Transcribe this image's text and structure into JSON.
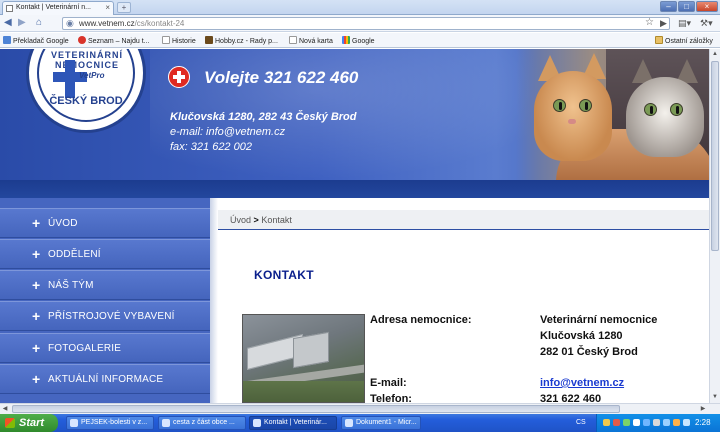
{
  "browser": {
    "tab_title": "Kontakt | Veterinární n...",
    "tab_close": "×",
    "new_tab": "+",
    "url_host": "www.vetnem.cz",
    "url_path": "/cs/kontakt-24",
    "window_controls": {
      "minimize": "–",
      "maximize": "□",
      "close": "×"
    },
    "nav_icons": {
      "back": "back-arrow-icon",
      "forward": "forward-arrow-icon",
      "home": "home-icon",
      "star": "star-icon",
      "go": "go-arrow-icon",
      "page": "page-menu-icon",
      "tools": "wrench-icon"
    },
    "bookmarks": [
      {
        "label": "Překladač Google"
      },
      {
        "label": "Seznam – Najdu t..."
      },
      {
        "label": "Historie"
      },
      {
        "label": "Hobby.cz - Rady p..."
      },
      {
        "label": "Nová karta"
      },
      {
        "label": "Google"
      }
    ],
    "other_bookmarks": "Ostatní záložky"
  },
  "header": {
    "logo_top_text": "VETERINÁRNÍ NEMOCNICE",
    "logo_brand": "VetPro",
    "logo_city": "ČESKÝ BROD",
    "call_text": "Volejte 321 622 460",
    "address": "Klučovská 1280, 282 43 Český Brod",
    "email": "e-mail: info@vetnem.cz",
    "fax": "fax: 321 622 002"
  },
  "menu": {
    "plus": "+",
    "items": [
      {
        "label": "ÚVOD"
      },
      {
        "label": "ODDĚLENÍ"
      },
      {
        "label": "NÁŠ TÝM"
      },
      {
        "label": "PŘÍSTROJOVÉ VYBAVENÍ"
      },
      {
        "label": "FOTOGALERIE"
      },
      {
        "label": "AKTUÁLNÍ INFORMACE"
      }
    ]
  },
  "breadcrumb": {
    "home": "Úvod",
    "separator": ">",
    "current": "Kontakt"
  },
  "content": {
    "title": "KONTAKT",
    "address_label": "Adresa nemocnice:",
    "address_lines": [
      "Veterinární nemocnice",
      "Klučovská 1280",
      "282 01 Český Brod"
    ],
    "email_label": "E-mail:",
    "email_value": "info@vetnem.cz",
    "phone_label": "Telefon:",
    "phone_value": "321 622 460"
  },
  "taskbar": {
    "start": "Start",
    "tasks": [
      {
        "label": "PEJSEK-bolesti v z..."
      },
      {
        "label": "cesta z část obce ..."
      },
      {
        "label": "Kontakt | Veterinár..."
      },
      {
        "label": "Dokument1 - Micr..."
      }
    ],
    "language": "CS",
    "clock": "2:28"
  },
  "colors": {
    "header_blue": "#3f61c1",
    "menu_blue": "#4666c0",
    "title_navy": "#0a1f8c",
    "link_blue": "#1a3ad0",
    "cross_red": "#e02a21"
  }
}
